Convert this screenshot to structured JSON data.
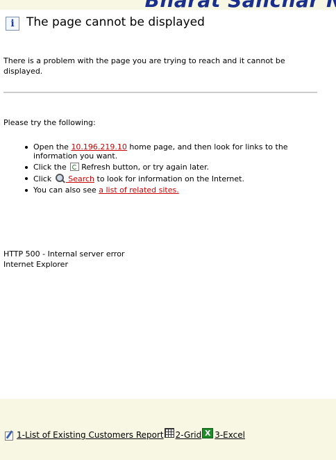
{
  "banner": {
    "text": "Bharat Sanchar N"
  },
  "error": {
    "title": "The page cannot be displayed",
    "description": "There is a problem with the page you are trying to reach and it cannot be displayed.",
    "try_heading": "Please try the following:",
    "suggestions": {
      "open_prefix": "Open the ",
      "host_link": "10.196.219.10",
      "open_suffix": " home page, and then look for links to the information you want.",
      "click_prefix": "Click the ",
      "refresh_suffix": "Refresh button, or try again later.",
      "click2_prefix": "Click ",
      "search_link": " Search",
      "search_suffix": " to look for information on the Internet.",
      "see_prefix": "You can also see ",
      "related_link": "a list of related sites."
    },
    "status_code": "HTTP 500 - Internal server error",
    "browser": "Internet Explorer"
  },
  "reports": {
    "link1": "1-List of Existing Customers Report",
    "link2": "2-Grid",
    "link3": "3-Excel"
  },
  "icons": {
    "info": "info-icon",
    "refresh": "refresh-icon",
    "search": "search-icon",
    "report": "pencil-icon",
    "grid": "grid-icon",
    "excel": "excel-icon"
  }
}
